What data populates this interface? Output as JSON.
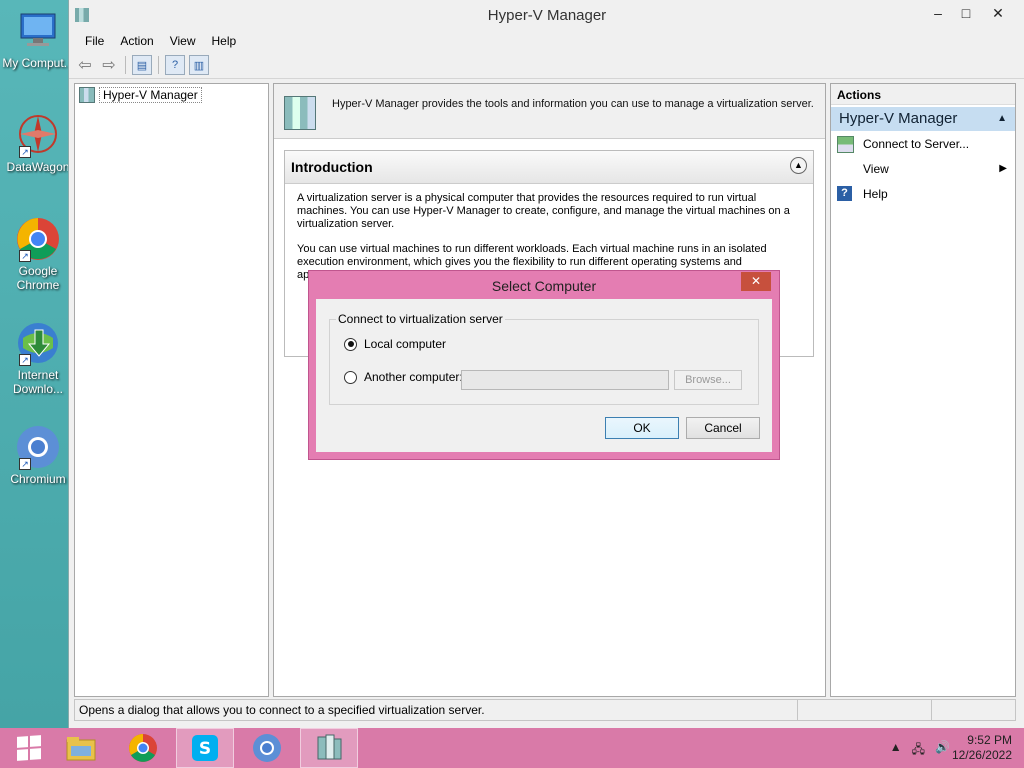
{
  "desktop": {
    "icons": [
      {
        "label": "My Comput...",
        "icon": "computer-icon"
      },
      {
        "label": "DataWagon",
        "icon": "datawagon-icon"
      },
      {
        "label": "Google Chrome",
        "icon": "chrome-icon"
      },
      {
        "label": "Internet Downlo...",
        "icon": "internet-download-manager-icon"
      },
      {
        "label": "Chromium",
        "icon": "chromium-icon"
      }
    ]
  },
  "window": {
    "title": "Hyper-V Manager",
    "menu": [
      "File",
      "Action",
      "View",
      "Help"
    ],
    "controls": {
      "minimize": "–",
      "maximize": "□",
      "close": "✕"
    }
  },
  "tree": {
    "root_label": "Hyper-V Manager"
  },
  "center": {
    "description": "Hyper-V Manager provides the tools and information you can use to manage a virtualization server.",
    "intro_title": "Introduction",
    "intro_p1": "A virtualization server is a physical computer that provides the resources required to run virtual machines. You can use Hyper-V Manager to create, configure, and manage the virtual machines on a virtualization server.",
    "intro_p2": "You can use virtual machines to run different workloads. Each virtual machine runs in an isolated execution environment, which gives you the flexibility to run different operating systems and applications on on"
  },
  "actions": {
    "header": "Actions",
    "section": "Hyper-V Manager",
    "items": [
      {
        "label": "Connect to Server...",
        "icon": "connect-server-icon"
      },
      {
        "label": "View",
        "icon": ""
      },
      {
        "label": "Help",
        "icon": "help-icon"
      }
    ]
  },
  "status": {
    "text": "Opens a dialog that allows you to connect to a specified virtualization server."
  },
  "dialog": {
    "title": "Select Computer",
    "group_label": "Connect to virtualization server",
    "option_local": "Local computer",
    "option_another": "Another computer:",
    "another_value": "",
    "browse_label": "Browse...",
    "ok_label": "OK",
    "cancel_label": "Cancel",
    "selected": "local"
  },
  "taskbar": {
    "items": [
      "file-explorer-icon",
      "chrome-icon",
      "skype-icon",
      "chromium-icon",
      "hyper-v-manager-icon"
    ],
    "time": "9:52 PM",
    "date": "12/26/2022",
    "colors": {
      "taskbar": "#d97aa8",
      "dialog_frame": "#e47db2",
      "desktop": "#4da6a6"
    }
  }
}
